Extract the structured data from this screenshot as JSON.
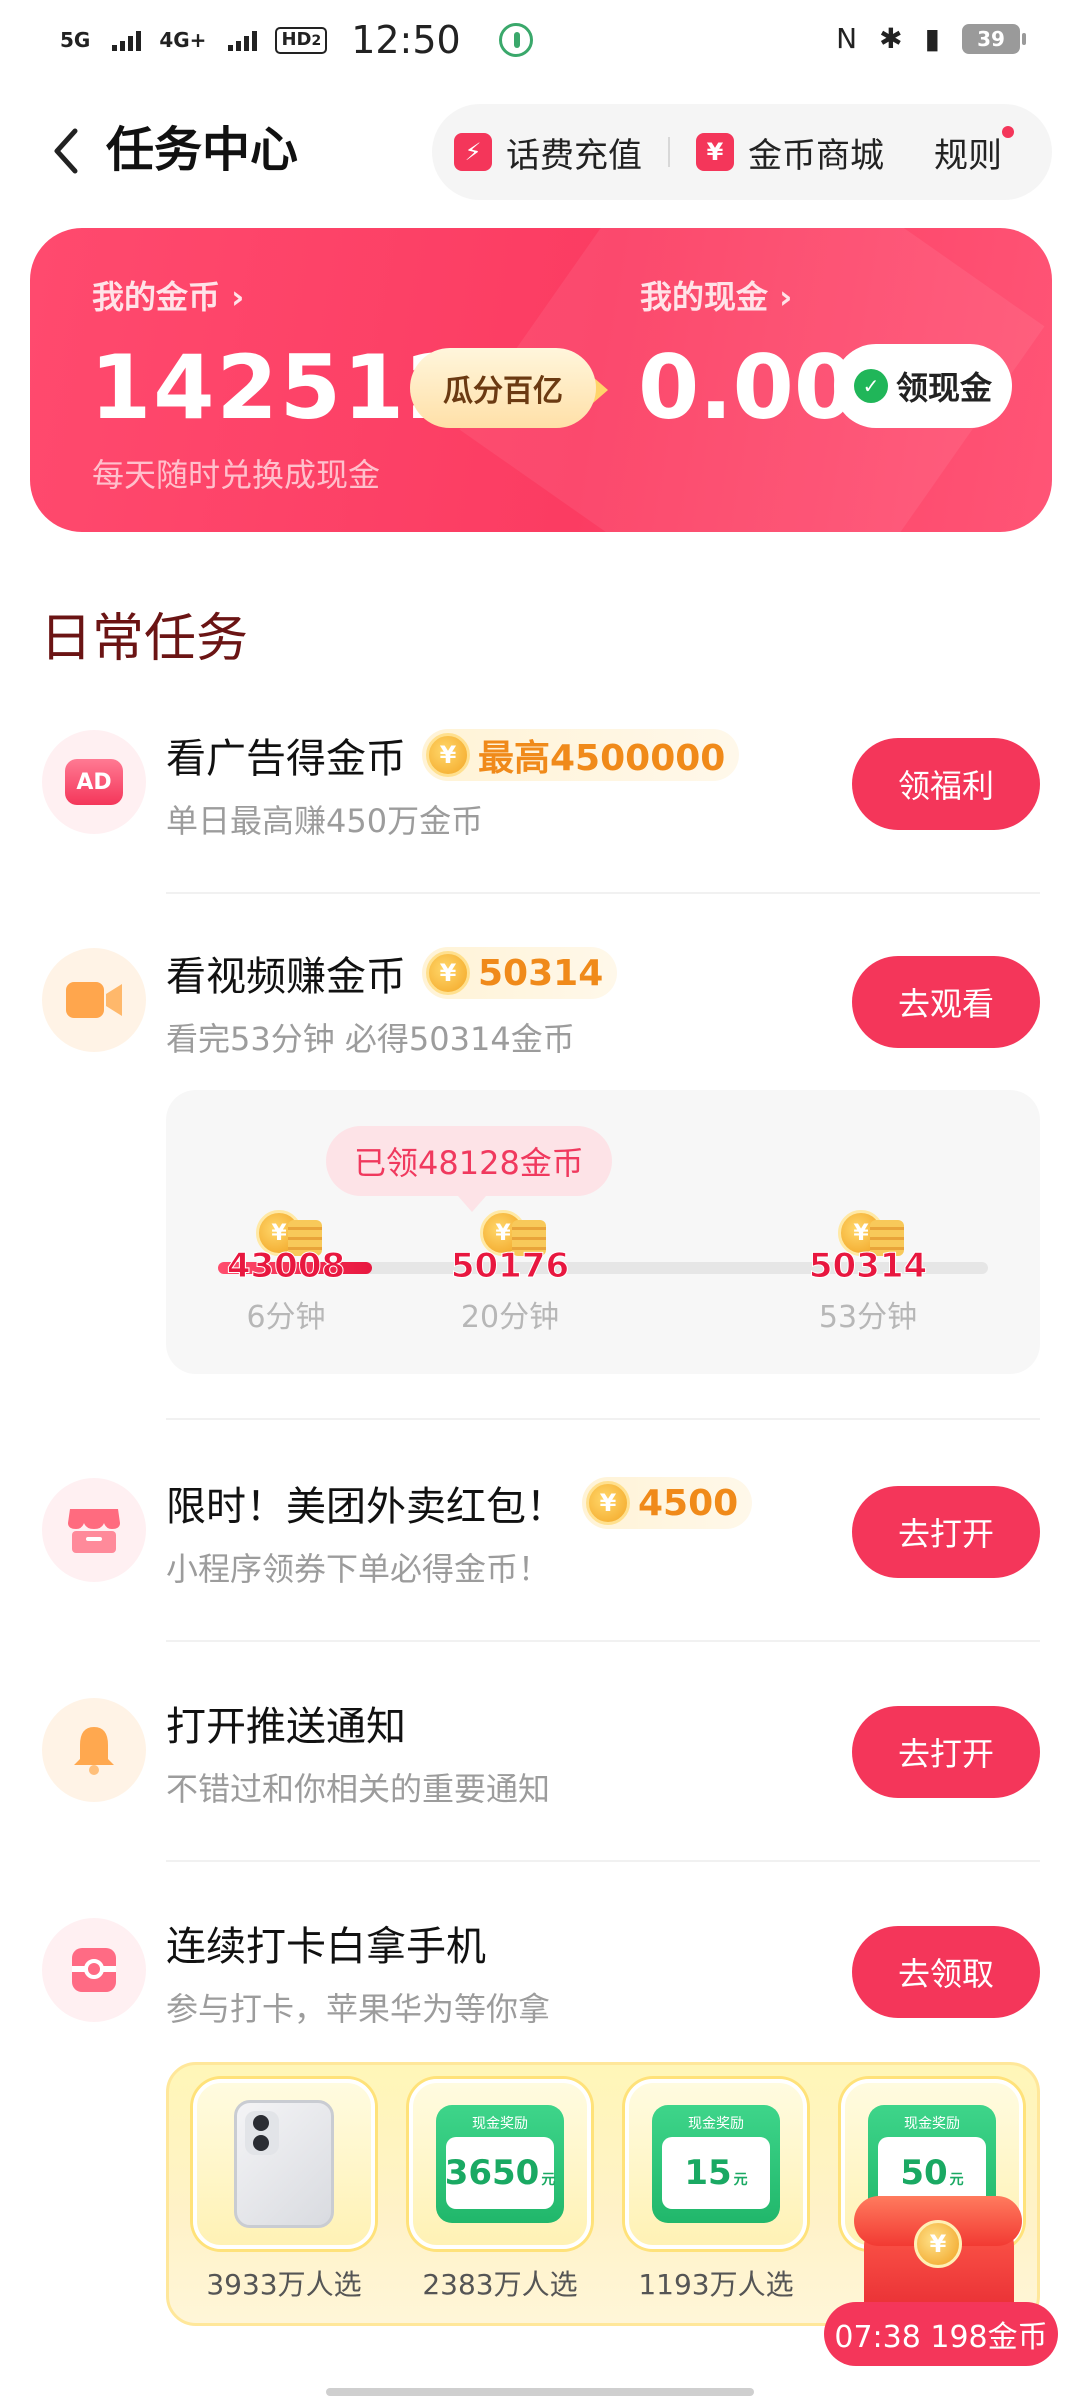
{
  "status_bar": {
    "signal1": "5G",
    "signal2": "4G+",
    "hd": "HD",
    "hd_sub": "2",
    "time": "12:50",
    "nfc": "N",
    "bluetooth": "✱",
    "vibrate": "▮",
    "battery": "39"
  },
  "header": {
    "title": "任务中心",
    "recharge_label": "话费充值",
    "mall_label": "金币商城",
    "rules_label": "规则"
  },
  "wallet": {
    "coins_label": "我的金币 ›",
    "coins_value": "142512",
    "badge": "瓜分百亿",
    "cash_label": "我的现金 ›",
    "cash_value": "0.00",
    "cashout_label": "领现金",
    "hint": "每天随时兑换成现金",
    "accent": "#fb3c62"
  },
  "section": {
    "title": "日常任务"
  },
  "tasks": [
    {
      "title": "看广告得金币",
      "reward": "最高4500000",
      "sub": "单日最高赚450万金币",
      "button": "领福利",
      "icon": "ad-icon"
    },
    {
      "title": "看视频赚金币",
      "reward": "50314",
      "sub": "看完53分钟 必得50314金币",
      "button": "去观看",
      "icon": "video-camera-icon"
    },
    {
      "title": "限时！美团外卖红包！",
      "reward": "4500",
      "sub": "小程序领券下单必得金币！",
      "button": "去打开",
      "icon": "shop-icon"
    },
    {
      "title": "打开推送通知",
      "reward": "",
      "sub": "不错过和你相关的重要通知",
      "button": "去打开",
      "icon": "bell-icon"
    },
    {
      "title": "连续打卡白拿手机",
      "reward": "",
      "sub": "参与打卡，苹果华为等你拿",
      "button": "去领取",
      "icon": "checkin-icon"
    }
  ],
  "video_progress": {
    "claimed_tip": "已领48128金币",
    "progress_fraction": 0.2,
    "milestones": [
      {
        "value": "43008",
        "time": "6分钟"
      },
      {
        "value": "50176",
        "time": "20分钟"
      },
      {
        "value": "50314",
        "time": "53分钟"
      }
    ]
  },
  "prizes": [
    {
      "type": "phone",
      "count": "3933万人选"
    },
    {
      "type": "cash",
      "label": "现金奖励",
      "amount": "3650",
      "unit": "元",
      "count": "2383万人选"
    },
    {
      "type": "cash",
      "label": "现金奖励",
      "amount": "15",
      "unit": "元",
      "count": "1193万人选"
    },
    {
      "type": "cash",
      "label": "现金奖励",
      "amount": "50",
      "unit": "元",
      "count": ""
    }
  ],
  "float_widget": {
    "timer": "07:38 198金币"
  },
  "coin_glyph": "¥"
}
